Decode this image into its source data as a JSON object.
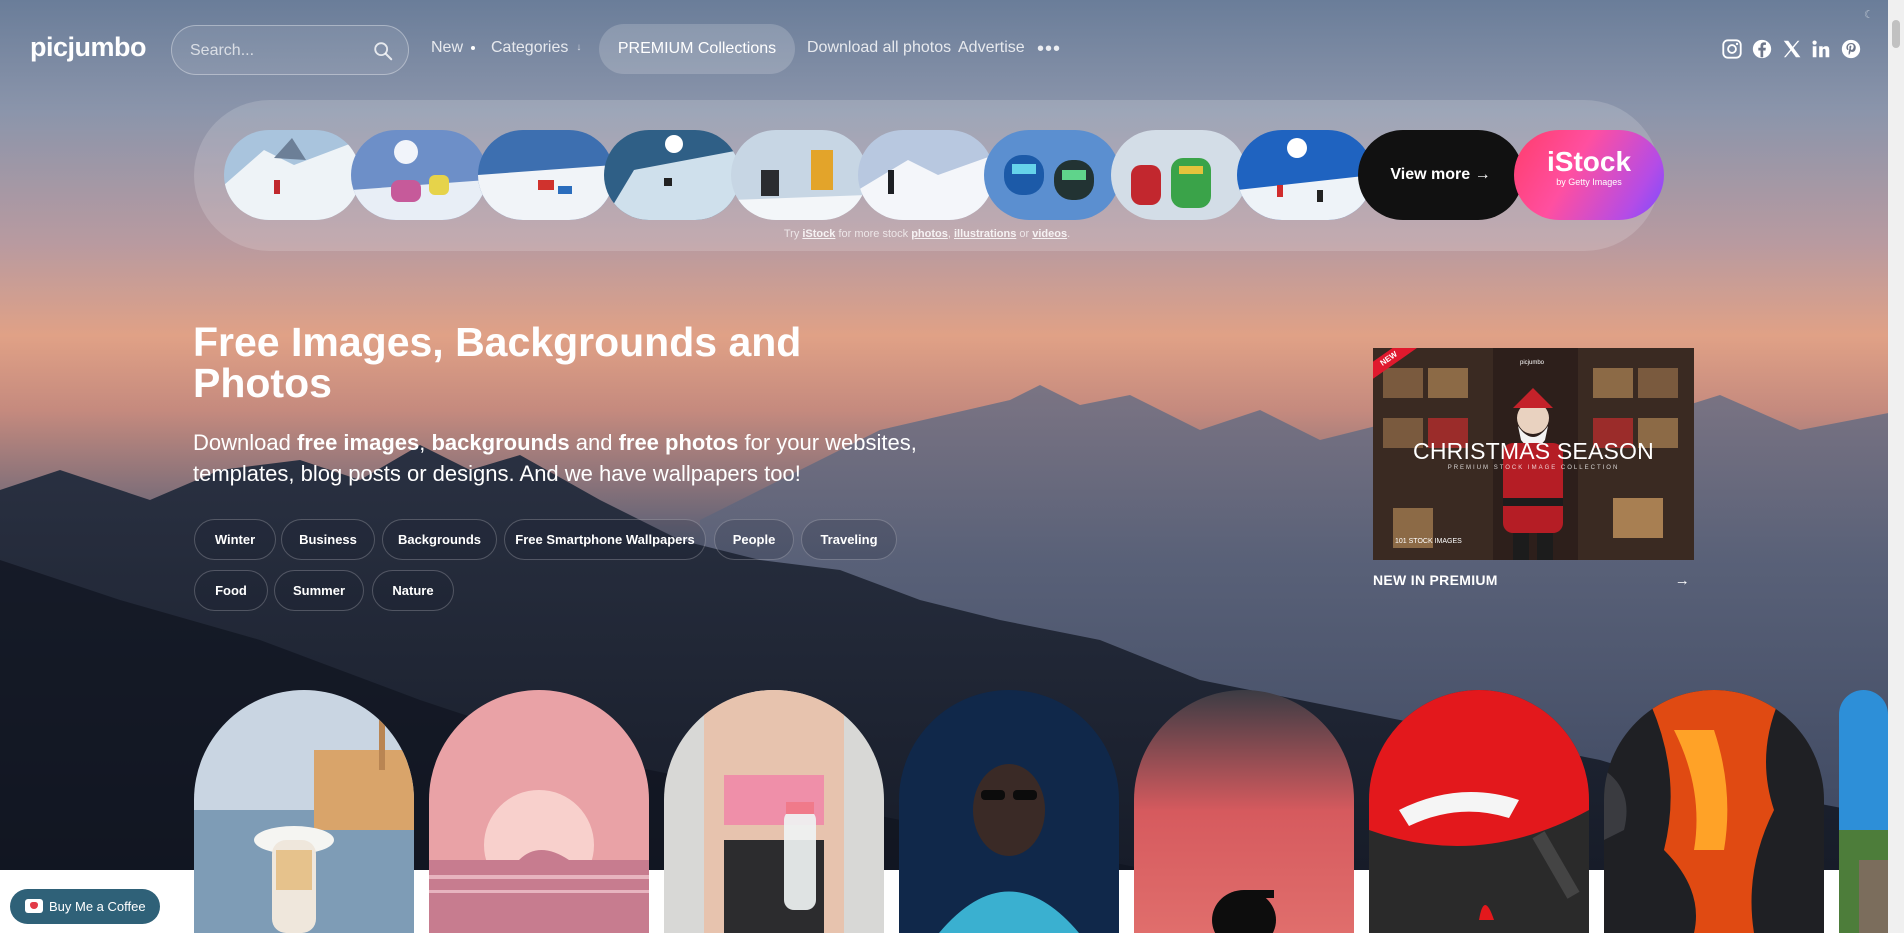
{
  "brand": {
    "logo": "picjumbo"
  },
  "search": {
    "placeholder": "Search..."
  },
  "nav": {
    "new": "New",
    "categories": "Categories",
    "categories_mark": "↓",
    "premium": "PREMIUM Collections",
    "download_all": "Download all photos",
    "advertise": "Advertise",
    "more": "•••"
  },
  "social": [
    "instagram-icon",
    "facebook-icon",
    "x-icon",
    "linkedin-icon",
    "pinterest-icon"
  ],
  "stock": {
    "view_more": "View more →",
    "istock_big": "iStock",
    "istock_small": "by Getty Images",
    "note_prefix": "Try ",
    "note_istock": "iStock",
    "note_mid": " for more stock ",
    "note_photos": "photos",
    "note_comma": ", ",
    "note_illustrations": "illustrations",
    "note_or": " or ",
    "note_videos": "videos",
    "note_end": "."
  },
  "hero": {
    "title": "Free Images, Backgrounds and Photos",
    "sub_1": "Download ",
    "sub_b1": "free images",
    "sub_2": ", ",
    "sub_b2": "backgrounds",
    "sub_3": " and ",
    "sub_b3": "free photos",
    "sub_4": " for your websites, templates, blog posts or designs. And we have wallpapers too!"
  },
  "tags": [
    "Winter",
    "Business",
    "Backgrounds",
    "Free Smartphone Wallpapers",
    "People",
    "Traveling",
    "Food",
    "Summer",
    "Nature"
  ],
  "promo": {
    "ribbon": "NEW",
    "brand": "picjumbo",
    "title": "CHRISTMAS SEASON",
    "subtitle": "PREMIUM STOCK IMAGE COLLECTION",
    "count": "101 STOCK IMAGES",
    "link": "NEW IN PREMIUM",
    "arrow": "→"
  },
  "coffee": {
    "label": "Buy Me a Coffee"
  },
  "colors": {
    "coffee_button": "#2f6178",
    "istock_gradient_start": "#ff3d6b",
    "istock_gradient_end": "#7a4dff",
    "ribbon": "#e0192d"
  }
}
